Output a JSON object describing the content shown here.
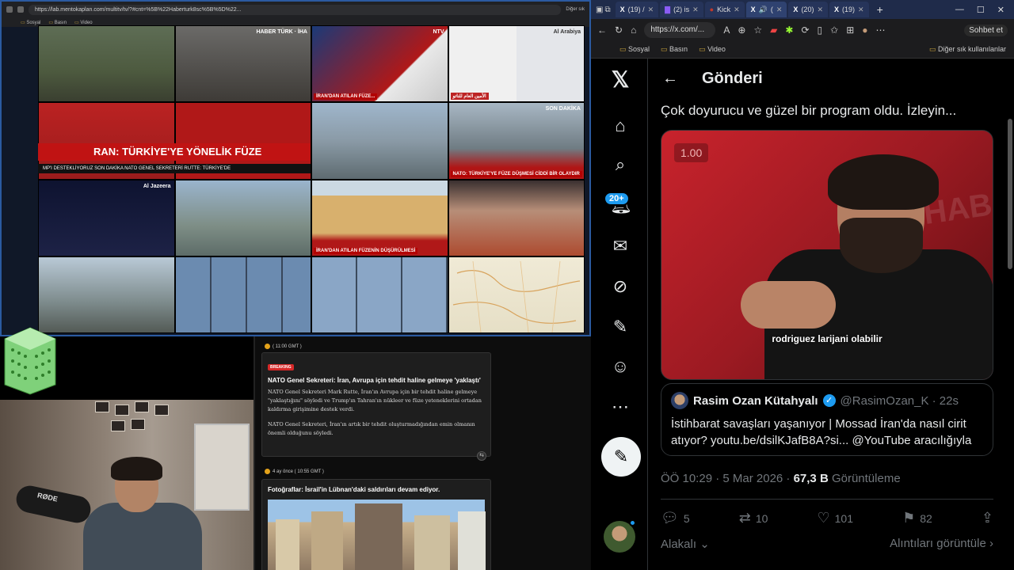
{
  "left_browser": {
    "url": "https://lab.mentokaplan.com/multitv/tv/?#cnt=%5B%22Haberturk8sc%5B%5D%22...",
    "bookmarks": [
      "Sosyal",
      "Basın",
      "Video"
    ],
    "other_bookmarks": "Diğer sık"
  },
  "tv_tiles": [
    {
      "logo": "",
      "label": ""
    },
    {
      "logo": "HABER TÜRK · İHA",
      "label": ""
    },
    {
      "logo": "NTV",
      "label": "İRAN'DAN ATILAN FÜZE..."
    },
    {
      "logo": "Al Arabiya",
      "label": "الأمين العام للناتو"
    },
    {
      "logo": "",
      "label": ""
    },
    {
      "logo": "",
      "label": ""
    },
    {
      "logo": "SON DAKİKA",
      "label": "NATO: TÜRKİYE'YE FÜZE DÜŞMESİ CİDDİ BİR OLAYDIR"
    },
    {
      "logo": "Al Jazeera",
      "label": ""
    },
    {
      "logo": "",
      "label": ""
    },
    {
      "logo": "",
      "label": "İRAN'DAN ATILAN FÜZENİN DÜŞÜRÜLMESİ"
    },
    {
      "logo": "",
      "label": ""
    },
    {
      "logo": "",
      "label": ""
    },
    {
      "logo": "",
      "label": ""
    },
    {
      "logo": "",
      "label": ""
    },
    {
      "logo": "",
      "label": ""
    },
    {
      "logo": "",
      "label": ""
    }
  ],
  "ticker": {
    "headline": "RAN: TÜRKİYE'YE YÖNELİK FÜZE",
    "sub": "MP'I DESTEKLİYORUZ  SON DAKİKA  NATO GENEL SEKRETERİ RUTTE: TÜRKİYE'DE"
  },
  "news_feed": {
    "time1": "( 11:00 GMT )",
    "badge": "BREAKING",
    "title1": "NATO Genel Sekreteri: İran, Avrupa için tehdit haline gelmeye 'yaklaştı'",
    "body1a": "NATO Genel Sekreteri Mark Rutte, İran'ın Avrupa için bir tehdit haline gelmeye \"yaklaştığını\" söyledi ve Trump'ın Tahran'ın nükleer ve füze yeteneklerini ortadan kaldırma girişimine destek verdi.",
    "body1b": "NATO Genel Sekreteri, İran'ın artık bir tehdit oluşturmadığından emin olmanın önemli olduğunu söyledi.",
    "time2": "4 ay önce  ( 10:55 GMT )",
    "title2": "Fotoğraflar: İsrail'in Lübnan'daki saldırıları devam ediyor."
  },
  "webcam": {
    "mic_brand": "RØDE"
  },
  "right_browser": {
    "tabs": [
      {
        "label": "(19) /"
      },
      {
        "label": "(2) is"
      },
      {
        "label": "Kick"
      },
      {
        "label": "( "
      },
      {
        "label": "(20)"
      },
      {
        "label": "(19)"
      }
    ],
    "url": "https://x.com/...",
    "chat_label": "Sohbet et",
    "bookmarks": [
      "Sosyal",
      "Basın",
      "Video"
    ],
    "other_bookmarks": "Diğer sık kullanılanlar"
  },
  "x_sidebar": {
    "notif_count": "20+"
  },
  "post": {
    "header": "Gönderi",
    "text": "Çok doyurucu ve güzel bir program oldu. İzleyin...",
    "video_speed": "1.00",
    "video_caption": "rodriguez larijani olabilir",
    "video_watermark": "R HAB",
    "quote": {
      "name": "Rasim Ozan Kütahyalı",
      "handle": "@RasimOzan_K · 22s",
      "text": "İstihbarat savaşları yaşanıyor | Mossad İran'da nasıl cirit atıyor? youtu.be/dsilKJafB8A?si... @YouTube aracılığıyla"
    },
    "meta_time": "ÖÖ 10:29 · 5 Mar 2026 · ",
    "meta_views": "67,3 B",
    "meta_views_label": " Görüntüleme",
    "replies": "5",
    "reposts": "10",
    "likes": "101",
    "bookmarks": "82",
    "relevant": "Alakalı",
    "quotes_link": "Alıntıları görüntüle"
  },
  "colors": {
    "accent": "#1d9bf0",
    "breaking_red": "#d62828",
    "border": "#2f3336"
  }
}
